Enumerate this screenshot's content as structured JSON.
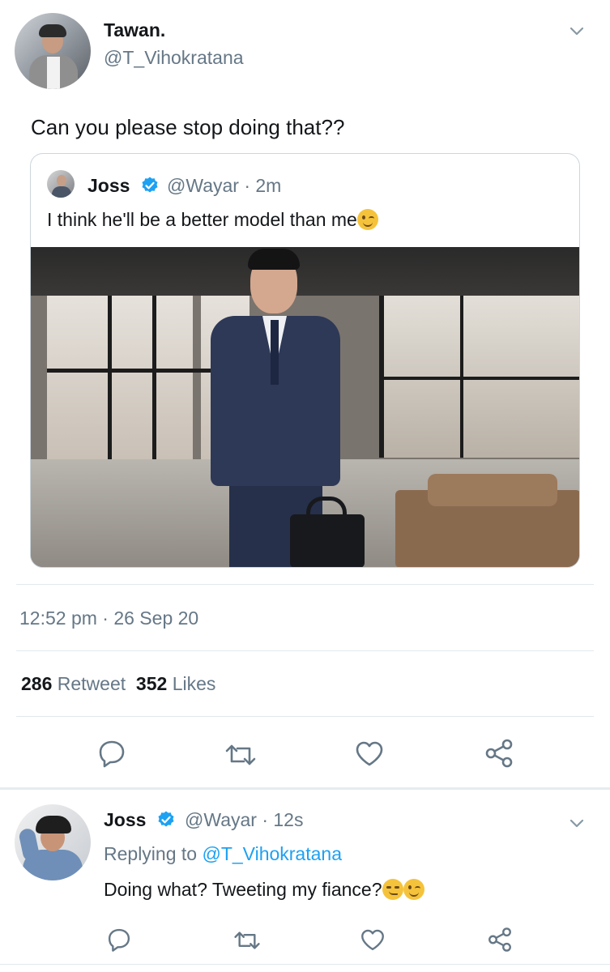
{
  "tweet": {
    "author_name": "Tawan.",
    "author_handle": "@T_Vihokratana",
    "text": "Can you please stop doing that??",
    "timestamp": "12:52 pm · 26 Sep 20",
    "retweet_count": "286",
    "retweet_label": "Retweet",
    "like_count": "352",
    "like_label": "Likes",
    "more_icon": "chevron-down-icon"
  },
  "quoted": {
    "author_name": "Joss",
    "author_handle": "@Wayar",
    "time_ago": "· 2m",
    "text": "I think he'll be a better model than me",
    "verified": true,
    "emoji": "winking-face"
  },
  "actions": [
    "reply-icon",
    "retweet-icon",
    "like-icon",
    "share-icon"
  ],
  "reply": {
    "author_name": "Joss",
    "author_handle": "@Wayar",
    "time_ago": "· 12s",
    "replying_prefix": "Replying to",
    "replying_handle": "@T_Vihokratana",
    "text": "Doing what? Tweeting my fiance?",
    "verified": true,
    "emojis": [
      "smirking-face",
      "winking-face"
    ]
  },
  "colors": {
    "accent": "#1da1f2",
    "muted": "#657786",
    "text": "#14171a",
    "divider": "#e1e8ed"
  }
}
